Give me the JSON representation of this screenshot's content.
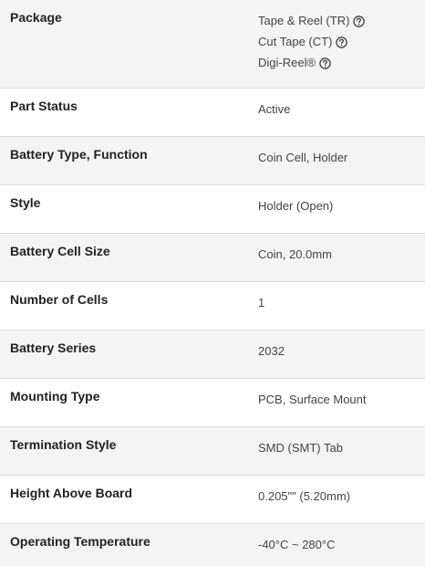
{
  "specs": {
    "package": {
      "label": "Package",
      "options": [
        {
          "text": "Tape & Reel (TR)",
          "help_icon": "question-circle-icon"
        },
        {
          "text": "Cut Tape (CT)",
          "help_icon": "question-circle-icon"
        },
        {
          "text": "Digi-Reel®",
          "help_icon": "question-circle-icon"
        }
      ]
    },
    "rows": [
      {
        "label": "Part Status",
        "value": "Active"
      },
      {
        "label": "Battery Type, Function",
        "value": "Coin Cell, Holder"
      },
      {
        "label": "Style",
        "value": "Holder (Open)"
      },
      {
        "label": "Battery Cell Size",
        "value": "Coin, 20.0mm"
      },
      {
        "label": "Number of Cells",
        "value": "1"
      },
      {
        "label": "Battery Series",
        "value": "2032"
      },
      {
        "label": "Mounting Type",
        "value": "PCB, Surface Mount"
      },
      {
        "label": "Termination Style",
        "value": "SMD (SMT) Tab"
      },
      {
        "label": "Height Above Board",
        "value": "0.205\"\" (5.20mm)"
      },
      {
        "label": "Operating Temperature",
        "value": "-40°C ~ 280°C"
      }
    ]
  },
  "colors": {
    "row_alt_background": "#f4f4f4",
    "row_background": "#ffffff",
    "divider": "#dcdcdc",
    "label_text": "#222222",
    "value_text": "#444444"
  }
}
